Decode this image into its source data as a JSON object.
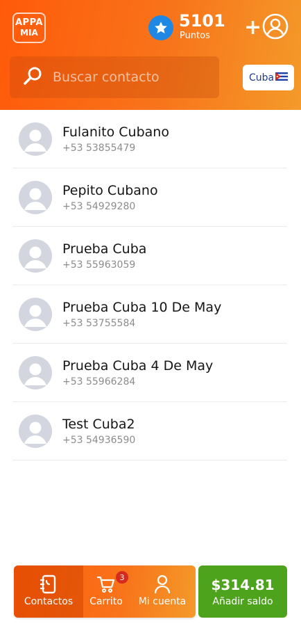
{
  "header": {
    "logo": {
      "line1": "APPA",
      "line2": "MIA"
    },
    "points": {
      "value": "5101",
      "label": "Puntos"
    },
    "add_icon": "plus-icon",
    "account_icon": "user-circle-icon",
    "search": {
      "placeholder": "Buscar contacto",
      "icon": "search-icon"
    },
    "country": {
      "label": "Cuba",
      "flag_icon": "cuba-flag-icon"
    },
    "colors": {
      "gradient_start": "#ff5a0a",
      "gradient_end": "#f49a2a",
      "star": "#1f88e5"
    }
  },
  "contacts": [
    {
      "name": "Fulanito Cubano",
      "phone": "+53 53855479"
    },
    {
      "name": "Pepito Cubano",
      "phone": "+53 54929280"
    },
    {
      "name": "Prueba Cuba",
      "phone": "+53 55963059"
    },
    {
      "name": "Prueba Cuba 10 De May",
      "phone": "+53 53755584"
    },
    {
      "name": "Prueba Cuba 4 De May",
      "phone": "+53 55966284"
    },
    {
      "name": "Test Cuba2",
      "phone": "+53 54936590"
    }
  ],
  "bottom_nav": {
    "items": [
      {
        "label": "Contactos",
        "icon": "contacts-icon",
        "active": true
      },
      {
        "label": "Carrito",
        "icon": "cart-icon",
        "badge": "3"
      },
      {
        "label": "Mi cuenta",
        "icon": "user-icon"
      }
    ]
  },
  "balance": {
    "amount": "$314.81",
    "label": "Añadir saldo",
    "color": "#4ea31c"
  }
}
